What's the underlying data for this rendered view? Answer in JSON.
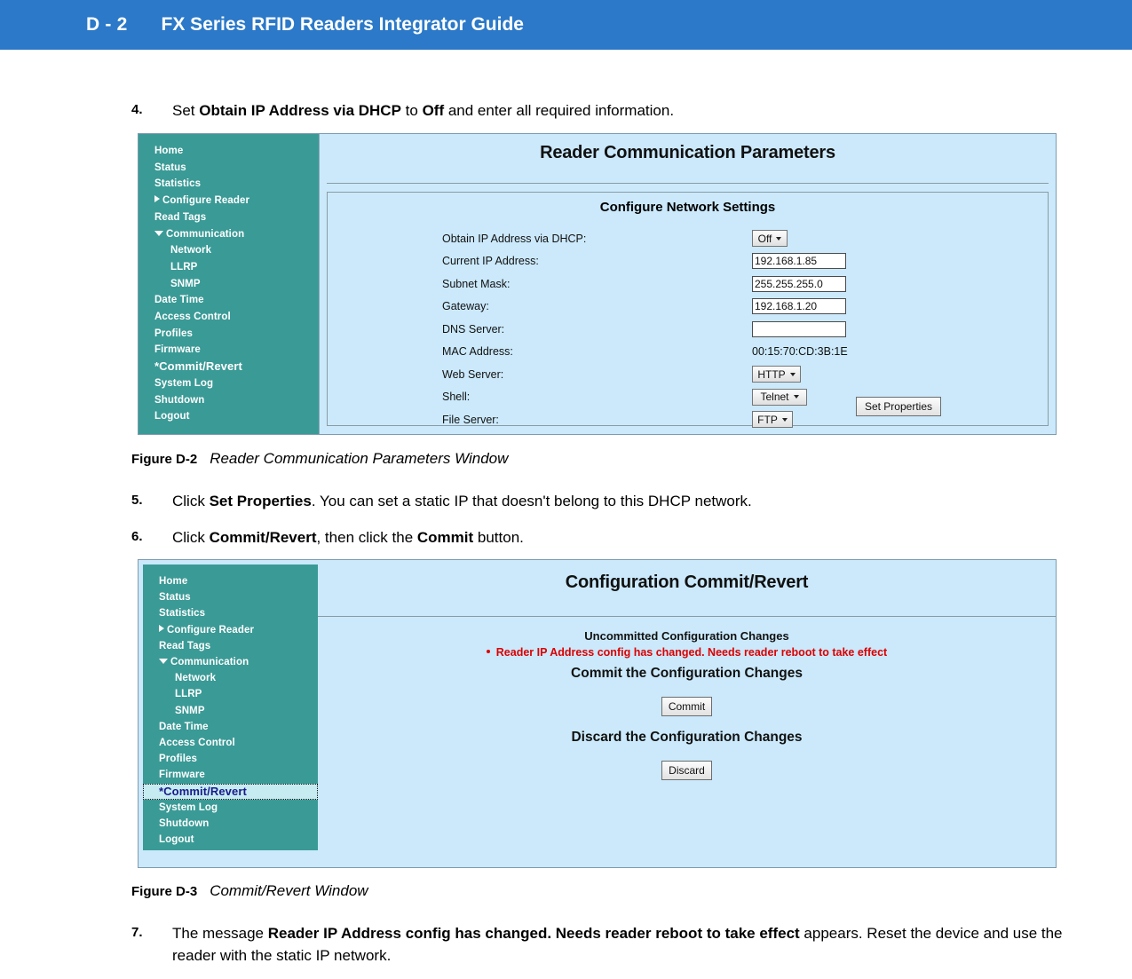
{
  "header": {
    "folio": "D - 2",
    "guide_title": "FX Series RFID Readers Integrator Guide",
    "band_color": "#2b79c8"
  },
  "steps": [
    {
      "number": "4.",
      "parts": [
        {
          "t": "Set ",
          "b": false
        },
        {
          "t": "Obtain IP Address via DHCP",
          "b": true
        },
        {
          "t": " to ",
          "b": false
        },
        {
          "t": "Off",
          "b": true
        },
        {
          "t": " and enter all required information.",
          "b": false
        }
      ]
    },
    {
      "number": "5.",
      "parts": [
        {
          "t": "Click ",
          "b": false
        },
        {
          "t": "Set Properties",
          "b": true
        },
        {
          "t": ". You can set a static IP that doesn't belong to this DHCP network.",
          "b": false
        }
      ]
    },
    {
      "number": "6.",
      "parts": [
        {
          "t": "Click ",
          "b": false
        },
        {
          "t": "Commit/Revert",
          "b": true
        },
        {
          "t": ", then click the ",
          "b": false
        },
        {
          "t": "Commit",
          "b": true
        },
        {
          "t": " button.",
          "b": false
        }
      ]
    },
    {
      "number": "7.",
      "parts": [
        {
          "t": "The message ",
          "b": false
        },
        {
          "t": "Reader IP Address config has changed. Needs reader reboot to take effect",
          "b": true
        },
        {
          "t": " appears. Reset the device and use the reader with the static IP network.",
          "b": false
        }
      ]
    }
  ],
  "figures": {
    "fig_d2": {
      "label": "Figure D-2",
      "title": "Reader Communication Parameters Window"
    },
    "fig_d3": {
      "label": "Figure D-3",
      "title": "Commit/Revert Window"
    }
  },
  "nav": {
    "teal": "#3a9a96",
    "selected_bg": "#c6ecf2",
    "selected_fg": "#1a1a8c",
    "items": [
      {
        "label": "Home",
        "level": 0,
        "caret": "none"
      },
      {
        "label": "Status",
        "level": 0,
        "caret": "none"
      },
      {
        "label": "Statistics",
        "level": 0,
        "caret": "none"
      },
      {
        "label": "Configure Reader",
        "level": 0,
        "caret": "right"
      },
      {
        "label": "Read Tags",
        "level": 0,
        "caret": "none"
      },
      {
        "label": "Communication",
        "level": 0,
        "caret": "down"
      },
      {
        "label": "Network",
        "level": 1,
        "caret": "none"
      },
      {
        "label": "LLRP",
        "level": 1,
        "caret": "none"
      },
      {
        "label": "SNMP",
        "level": 1,
        "caret": "none"
      },
      {
        "label": "Date Time",
        "level": 0,
        "caret": "none"
      },
      {
        "label": "Access Control",
        "level": 0,
        "caret": "none"
      },
      {
        "label": "Profiles",
        "level": 0,
        "caret": "none"
      },
      {
        "label": "Firmware",
        "level": 0,
        "caret": "none"
      },
      {
        "label": "*Commit/Revert",
        "level": 0,
        "caret": "none",
        "big": true
      },
      {
        "label": "System Log",
        "level": 0,
        "caret": "none"
      },
      {
        "label": "Shutdown",
        "level": 0,
        "caret": "none"
      },
      {
        "label": "Logout",
        "level": 0,
        "caret": "none"
      }
    ],
    "selected_index_fig2": 13
  },
  "reader_comm_window": {
    "title": "Reader Communication Parameters",
    "panel_heading": "Configure Network Settings",
    "fields": [
      {
        "label": "Obtain IP Address via DHCP:",
        "kind": "dropdown",
        "value": "Off",
        "width_class": "dd-off"
      },
      {
        "label": "Current IP Address:",
        "kind": "text",
        "value": "192.168.1.85"
      },
      {
        "label": "Subnet Mask:",
        "kind": "text",
        "value": "255.255.255.0"
      },
      {
        "label": "Gateway:",
        "kind": "text",
        "value": "192.168.1.20"
      },
      {
        "label": "DNS Server:",
        "kind": "text",
        "value": ""
      },
      {
        "label": "MAC Address:",
        "kind": "static",
        "value": "00:15:70:CD:3B:1E"
      },
      {
        "label": "Web Server:",
        "kind": "dropdown",
        "value": "HTTP",
        "width_class": "dd-http"
      },
      {
        "label": "Shell:",
        "kind": "dropdown",
        "value": "Telnet",
        "width_class": "dd-telnet"
      },
      {
        "label": "File Server:",
        "kind": "dropdown",
        "value": "FTP",
        "width_class": "dd-ftp"
      }
    ],
    "set_properties_button": "Set Properties"
  },
  "commit_revert_window": {
    "title": "Configuration Commit/Revert",
    "uncommitted_label": "Uncommitted Configuration Changes",
    "alert_text": "Reader IP Address config has changed. Needs reader reboot to take effect",
    "alert_color": "#dd0000",
    "commit_heading": "Commit the Configuration Changes",
    "commit_button": "Commit",
    "discard_heading": "Discard the Configuration Changes",
    "discard_button": "Discard"
  }
}
